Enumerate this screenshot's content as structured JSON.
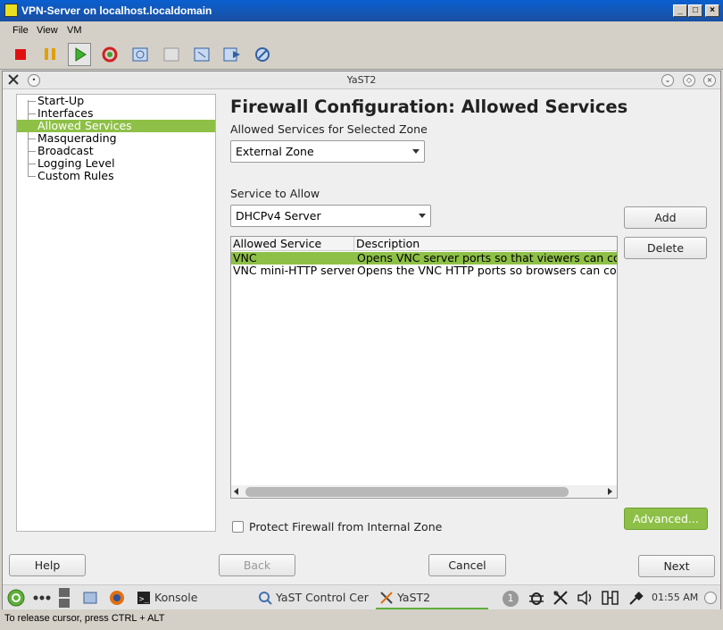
{
  "vbox": {
    "title": "VPN-Server on localhost.localdomain",
    "menu": [
      "File",
      "View",
      "VM"
    ],
    "toolbar": [
      "stop-icon",
      "pause-icon",
      "play-icon",
      "reset-icon",
      "snapshot-icon",
      "revert-snapshot-icon",
      "snapshot-manager-icon",
      "send-keys-icon",
      "settings-icon"
    ],
    "status": "To release cursor, press CTRL + ALT"
  },
  "yast": {
    "window_title": "YaST2",
    "page_title": "Firewall Configuration: Allowed Services",
    "tree": [
      "Start-Up",
      "Interfaces",
      "Allowed Services",
      "Masquerading",
      "Broadcast",
      "Logging Level",
      "Custom Rules"
    ],
    "zone_label": "Allowed Services for Selected Zone",
    "zone_value": "External Zone",
    "service_label": "Service to Allow",
    "service_value": "DHCPv4 Server",
    "add_label": "Add",
    "delete_label": "Delete",
    "table": {
      "headers": [
        "Allowed Service",
        "Description"
      ],
      "rows": [
        [
          "VNC",
          "Opens VNC server ports so that viewers can co"
        ],
        [
          "VNC mini-HTTP server",
          "Opens the VNC HTTP ports so browsers can co"
        ]
      ]
    },
    "protect_label": "Protect Firewall from Internal Zone",
    "advanced_label": "Advanced...",
    "help_label": "Help",
    "back_label": "Back",
    "cancel_label": "Cancel",
    "next_label": "Next"
  },
  "taskbar": {
    "konsole": "Konsole",
    "yast_cc": "YaST Control Cer",
    "yast2": "YaST2",
    "desktop_num": "1",
    "clock": "01:55 AM"
  },
  "colors": {
    "accent": "#8ec047",
    "titlebar": "#0a5fd0"
  }
}
